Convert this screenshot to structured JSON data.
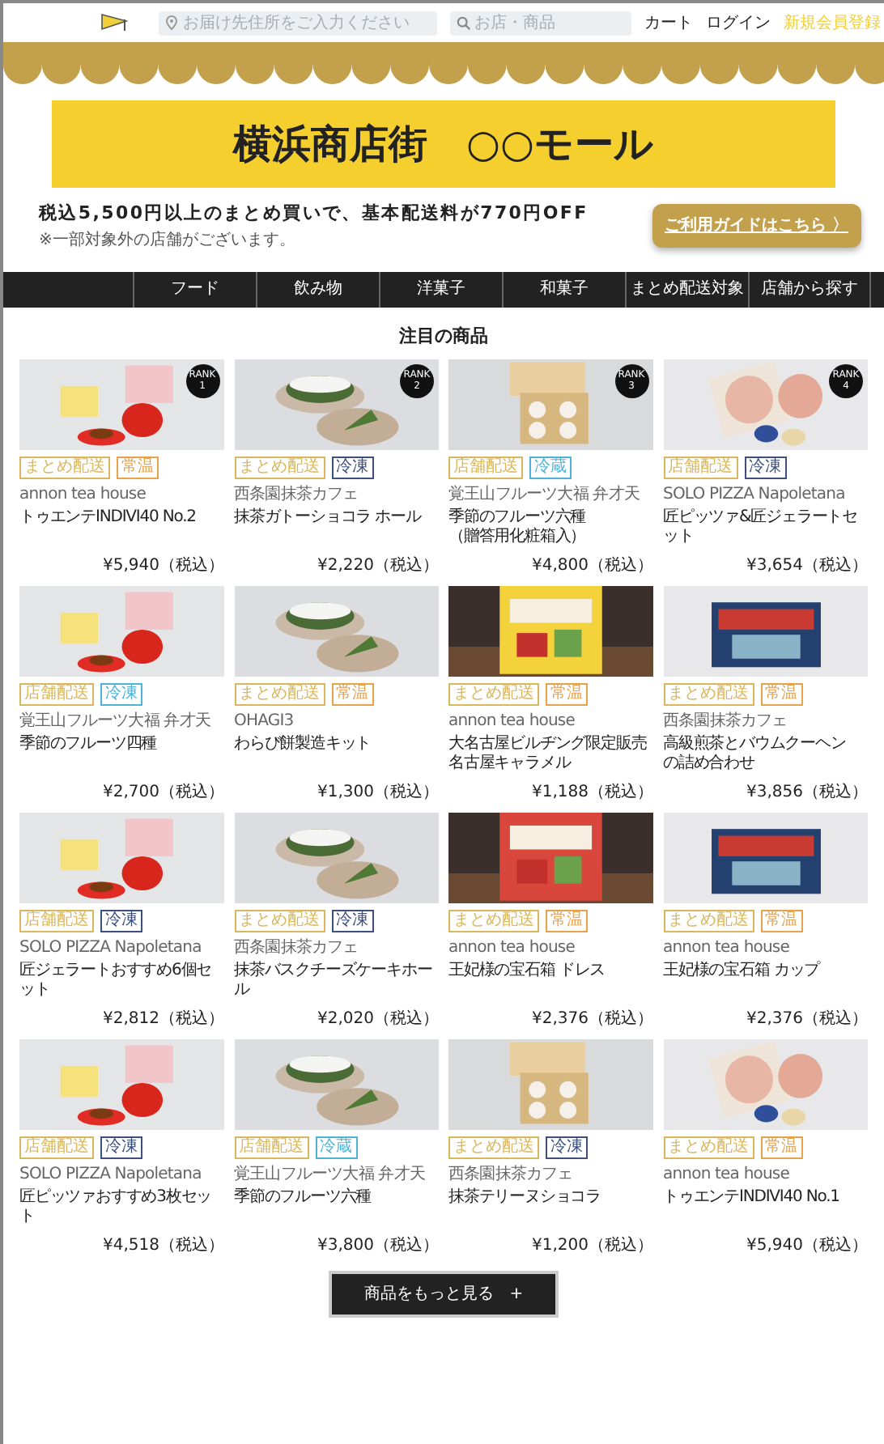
{
  "header": {
    "address_field": {
      "placeholder": "お届け先住所をご入力ください"
    },
    "search_field": {
      "placeholder": "お店・商品"
    },
    "links": [
      {
        "label": "カート",
        "kind": "plain"
      },
      {
        "label": "ログイン",
        "kind": "plain"
      },
      {
        "label": "新規会員登録",
        "kind": "highlight"
      }
    ]
  },
  "banner": {
    "title": "横浜商店街　○○モール"
  },
  "promo": {
    "text": "税込5,500円以上のまとめ買いで、基本配送料が770円OFF",
    "note": "※一部対象外の店舗がございます。",
    "guide_button": {
      "label": "ご利用ガイドはこちら",
      "icon": "〉"
    }
  },
  "nav": {
    "items": [
      "フード",
      "飲み物",
      "洋菓子",
      "和菓子",
      "まとめ配送対象",
      "店舗から探す"
    ]
  },
  "section_title": "注目の商品",
  "products": [
    {
      "rank_label": "RANK",
      "rank": "1",
      "tags": [
        {
          "label": "まとめ配送",
          "color": "#d9b75f"
        },
        {
          "label": "常温",
          "color": "#e8a24a"
        }
      ],
      "shop": "annon tea house",
      "name": "トゥエンテINDIVI40 No.2",
      "price": "¥5,940（税込）"
    },
    {
      "rank_label": "RANK",
      "rank": "2",
      "tags": [
        {
          "label": "まとめ配送",
          "color": "#d9b75f"
        },
        {
          "label": "冷凍",
          "color": "#3d4f7c"
        }
      ],
      "shop": "西条園抹茶カフェ",
      "name": "抹茶ガトーショコラ ホール",
      "price": "¥2,220（税込）"
    },
    {
      "rank_label": "RANK",
      "rank": "3",
      "tags": [
        {
          "label": "店舗配送",
          "color": "#d9b75f"
        },
        {
          "label": "冷蔵",
          "color": "#4fb3d9"
        }
      ],
      "shop": "覚王山フルーツ大福 弁才天",
      "name_lines": [
        "季節のフルーツ六種",
        "（贈答用化粧箱入）"
      ],
      "price": "¥4,800（税込）"
    },
    {
      "rank_label": "RANK",
      "rank": "4",
      "tags": [
        {
          "label": "店舗配送",
          "color": "#d9b75f"
        },
        {
          "label": "冷凍",
          "color": "#3d4f7c"
        }
      ],
      "shop": "SOLO PIZZA Napoletana",
      "name": "匠ピッツァ&匠ジェラートセット",
      "price": "¥3,654（税込）"
    },
    {
      "tags": [
        {
          "label": "店舗配送",
          "color": "#d9b75f"
        },
        {
          "label": "冷凍",
          "color": "#4fb3d9"
        }
      ],
      "shop": "覚王山フルーツ大福 弁才天",
      "name": "季節のフルーツ四種",
      "price": "¥2,700（税込）"
    },
    {
      "tags": [
        {
          "label": "まとめ配送",
          "color": "#d9b75f"
        },
        {
          "label": "常温",
          "color": "#e8a24a"
        }
      ],
      "shop": "OHAGI3",
      "name": "わらび餅製造キット",
      "price": "¥1,300（税込）"
    },
    {
      "tags": [
        {
          "label": "まとめ配送",
          "color": "#d9b75f"
        },
        {
          "label": "常温",
          "color": "#e8a24a"
        }
      ],
      "shop": "annon tea house",
      "name_lines": [
        "大名古屋ビルヂング限定販売",
        "名古屋キャラメル"
      ],
      "price": "¥1,188（税込）"
    },
    {
      "tags": [
        {
          "label": "まとめ配送",
          "color": "#d9b75f"
        },
        {
          "label": "常温",
          "color": "#e8a24a"
        }
      ],
      "shop": "西条園抹茶カフェ",
      "name_lines": [
        "高級煎茶とバウムクーヘン",
        "の詰め合わせ"
      ],
      "price": "¥3,856（税込）"
    },
    {
      "tags": [
        {
          "label": "店舗配送",
          "color": "#d9b75f"
        },
        {
          "label": "冷凍",
          "color": "#3d4f7c"
        }
      ],
      "shop": "SOLO PIZZA Napoletana",
      "name": "匠ジェラートおすすめ6個セット",
      "price": "¥2,812（税込）"
    },
    {
      "tags": [
        {
          "label": "まとめ配送",
          "color": "#d9b75f"
        },
        {
          "label": "冷凍",
          "color": "#3d4f7c"
        }
      ],
      "shop": "西条園抹茶カフェ",
      "name": "抹茶バスクチーズケーキホール",
      "price": "¥2,020（税込）"
    },
    {
      "tags": [
        {
          "label": "まとめ配送",
          "color": "#d9b75f"
        },
        {
          "label": "常温",
          "color": "#e8a24a"
        }
      ],
      "shop": "annon tea house",
      "name": "王妃様の宝石箱 ドレス",
      "price": "¥2,376（税込）"
    },
    {
      "tags": [
        {
          "label": "まとめ配送",
          "color": "#d9b75f"
        },
        {
          "label": "常温",
          "color": "#e8a24a"
        }
      ],
      "shop": "annon tea house",
      "name": "王妃様の宝石箱 カップ",
      "price": "¥2,376（税込）"
    },
    {
      "tags": [
        {
          "label": "店舗配送",
          "color": "#d9b75f"
        },
        {
          "label": "冷凍",
          "color": "#3d4f7c"
        }
      ],
      "shop": "SOLO PIZZA Napoletana",
      "name": "匠ピッツァおすすめ3枚セット",
      "price": "¥4,518（税込）"
    },
    {
      "tags": [
        {
          "label": "店舗配送",
          "color": "#d9b75f"
        },
        {
          "label": "冷蔵",
          "color": "#4fb3d9"
        }
      ],
      "shop": "覚王山フルーツ大福 弁才天",
      "name": "季節のフルーツ六種",
      "price": "¥3,800（税込）"
    },
    {
      "tags": [
        {
          "label": "まとめ配送",
          "color": "#d9b75f"
        },
        {
          "label": "冷凍",
          "color": "#3d4f7c"
        }
      ],
      "shop": "西条園抹茶カフェ",
      "name": "抹茶テリーヌショコラ",
      "price": "¥1,200（税込）"
    },
    {
      "tags": [
        {
          "label": "まとめ配送",
          "color": "#d9b75f"
        },
        {
          "label": "常温",
          "color": "#e8a24a"
        }
      ],
      "shop": "annon tea house",
      "name": "トゥエンテINDIVI40 No.1",
      "price": "¥5,940（税込）"
    }
  ],
  "more_button": {
    "label": "商品をもっと見る",
    "icon": "+"
  }
}
